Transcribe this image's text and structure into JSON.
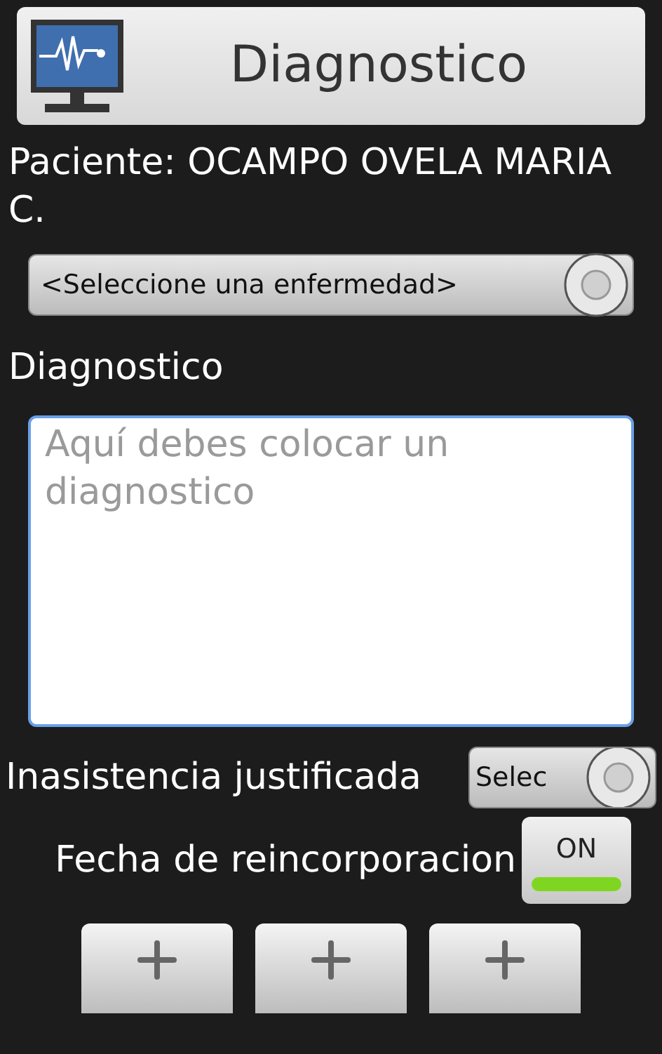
{
  "header": {
    "title": "Diagnostico"
  },
  "patient": "Paciente: OCAMPO OVELA MARIA C.",
  "disease_select": {
    "value": "<Seleccione una enfermedad>"
  },
  "diagnosis": {
    "label": "Diagnostico",
    "placeholder": "Aquí debes colocar un diagnostico"
  },
  "absence": {
    "label": "Inasistencia justificada",
    "value": "Selec"
  },
  "return_date": {
    "label": "Fecha de reincorporacion",
    "toggle": {
      "text": "ON",
      "on": true
    }
  },
  "date_pickers": [
    {
      "kind": "plus"
    },
    {
      "kind": "plus"
    },
    {
      "kind": "plus"
    }
  ]
}
